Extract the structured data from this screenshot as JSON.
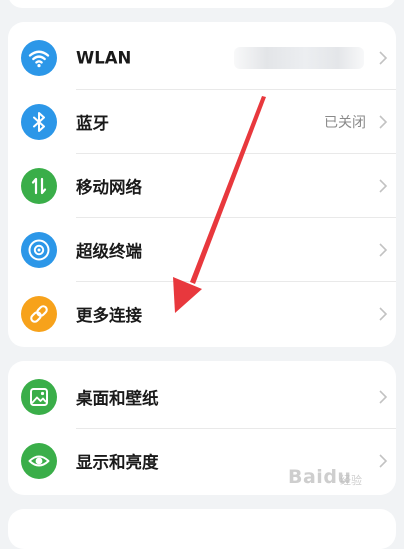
{
  "network_section": {
    "items": [
      {
        "label": "WLAN",
        "value": "",
        "icon": "wifi-icon",
        "color": "#2c97e8"
      },
      {
        "label": "蓝牙",
        "value": "已关闭",
        "icon": "bluetooth-icon",
        "color": "#2c97e8"
      },
      {
        "label": "移动网络",
        "value": "",
        "icon": "mobile-network-icon",
        "color": "#3aae49"
      },
      {
        "label": "超级终端",
        "value": "",
        "icon": "super-device-icon",
        "color": "#2c97e8"
      },
      {
        "label": "更多连接",
        "value": "",
        "icon": "link-icon",
        "color": "#f7a21b"
      }
    ]
  },
  "display_section": {
    "items": [
      {
        "label": "桌面和壁纸",
        "icon": "wallpaper-icon",
        "color": "#3aae49"
      },
      {
        "label": "显示和亮度",
        "icon": "eye-icon",
        "color": "#3aae49"
      }
    ]
  },
  "watermark": {
    "text": "Baidu",
    "sub": "经验"
  },
  "annotation_color": "#e8383d"
}
